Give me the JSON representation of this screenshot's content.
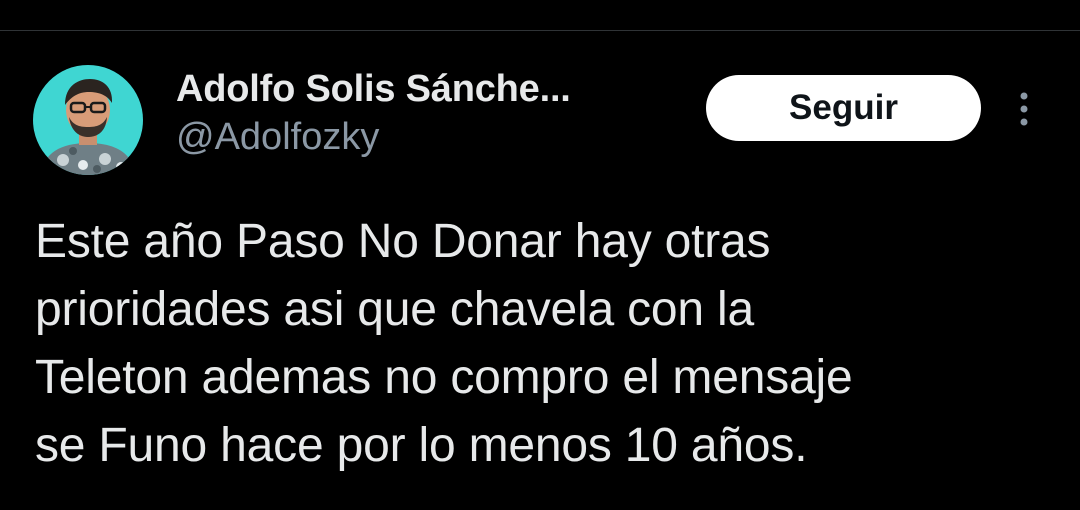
{
  "colors": {
    "background": "#000000",
    "primary_text": "#e7e9ea",
    "secondary_text": "#8b98a5",
    "button_background": "#ffffff",
    "button_text": "#0f1419",
    "avatar_background": "#3fd6d2"
  },
  "tweet": {
    "author": {
      "display_name": "Adolfo Solis Sánche...",
      "handle": "@Adolfozky",
      "avatar_icon": "user-avatar-photo"
    },
    "follow_button_label": "Seguir",
    "more_icon": "more-vertical-icon",
    "text": "Este año Paso No Donar hay otras\nprioridades asi que chavela con la\nTeleton ademas no compro el mensaje\nse Funo hace por lo menos 10 años."
  }
}
